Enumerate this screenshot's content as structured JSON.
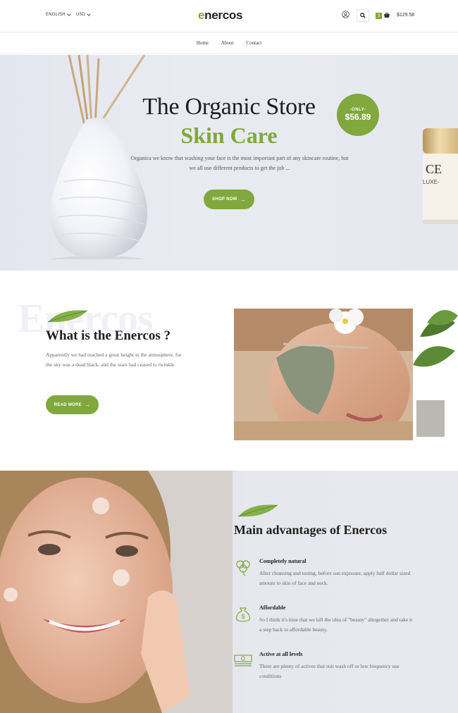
{
  "header": {
    "language": "ENGLISH",
    "currency": "USD",
    "logo_first": "e",
    "logo_rest": "nercos",
    "cart_count": "3",
    "cart_total": "$129.58"
  },
  "nav": {
    "items": [
      "Home",
      "About",
      "Contact"
    ]
  },
  "hero": {
    "title": "The Organic Store",
    "subtitle": "Skin Care",
    "text": "Organica we know that washing your face is the most important part of any skincare routine, but we all use different products to get the job ...",
    "button": "SHOP NOW",
    "badge_label": "-ONLY-",
    "badge_price": "$56.89",
    "jar_text": "CE",
    "jar_text2": "LUXE-"
  },
  "about": {
    "bg_text": "Enercos",
    "title": "What is the Enercos ?",
    "text": "Apparently we had reached a great height in the atmosphere, for the sky was a dead black, and the stars had ceased to twinkle.",
    "button": "READ MORE"
  },
  "advantages": {
    "title": "Main advantages of Enercos",
    "features": [
      {
        "icon": "clover-icon",
        "title": "Completely natural",
        "text": "After cleansing and toning, before sun exposure, apply half dollar sized amount to skin of face and neck."
      },
      {
        "icon": "money-bag-icon",
        "title": "Affordable",
        "text": "So I think it's time that we kill the idea of \"beauty\" altogether and take it a step back to affordable beauty."
      },
      {
        "icon": "cash-stack-icon",
        "title": "Active at all levels",
        "text": "There are plenty of actives that suit wash off or low frequency use conditions"
      }
    ]
  },
  "colors": {
    "accent": "#80a83c"
  }
}
